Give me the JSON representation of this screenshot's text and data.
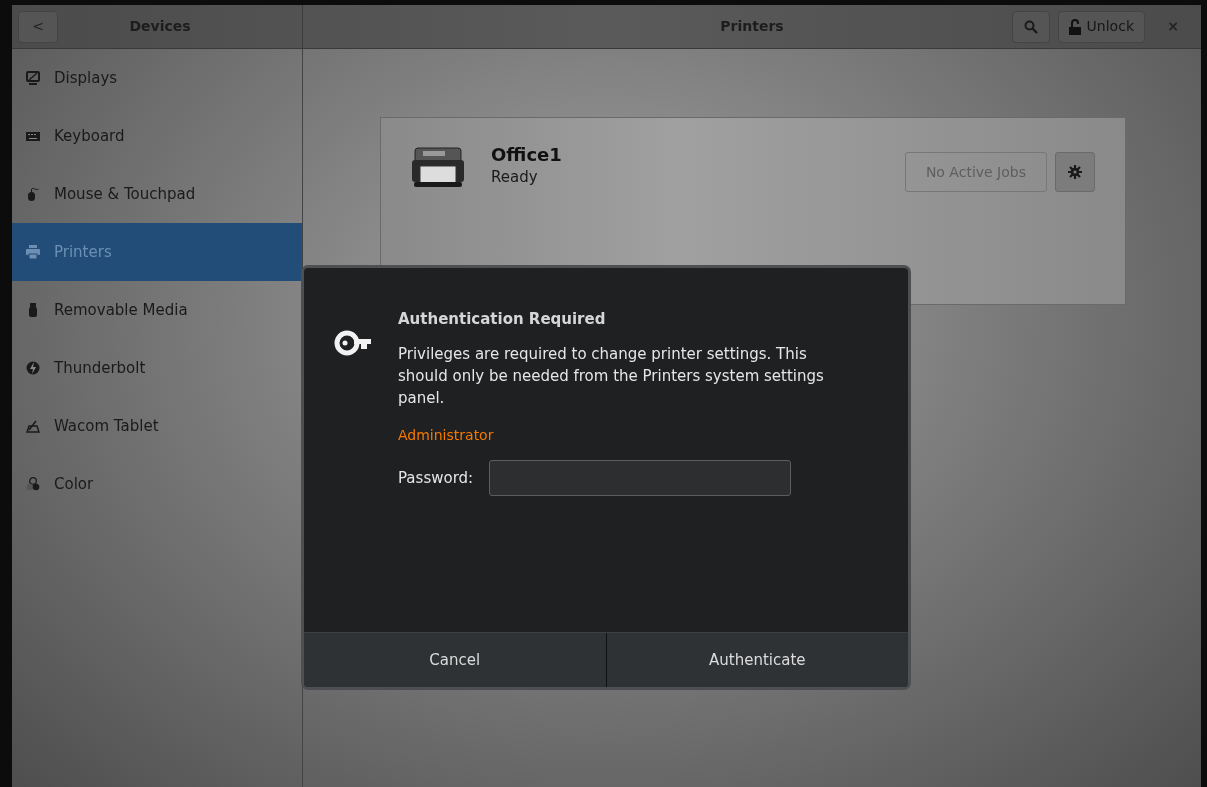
{
  "header": {
    "back_symbol": "<",
    "sidebar_title": "Devices",
    "title": "Printers",
    "unlock_label": "Unlock",
    "close_symbol": "×"
  },
  "sidebar": {
    "items": [
      {
        "label": "Displays",
        "kind": "display",
        "selected": false
      },
      {
        "label": "Keyboard",
        "kind": "keyboard",
        "selected": false
      },
      {
        "label": "Mouse & Touchpad",
        "kind": "mouse",
        "selected": false
      },
      {
        "label": "Printers",
        "kind": "printer",
        "selected": true
      },
      {
        "label": "Removable Media",
        "kind": "usb",
        "selected": false
      },
      {
        "label": "Thunderbolt",
        "kind": "bolt",
        "selected": false
      },
      {
        "label": "Wacom Tablet",
        "kind": "tablet",
        "selected": false
      },
      {
        "label": "Color",
        "kind": "color",
        "selected": false
      }
    ]
  },
  "printer": {
    "name": "Office1",
    "status": "Ready",
    "jobs_label": "No Active Jobs"
  },
  "dialog": {
    "title": "Authentication Required",
    "message": "Privileges are required to change printer settings. This should only be needed from the Printers system settings panel.",
    "user": "Administrator",
    "password_label": "Password:",
    "buttons": [
      "Cancel",
      "Authenticate"
    ]
  }
}
